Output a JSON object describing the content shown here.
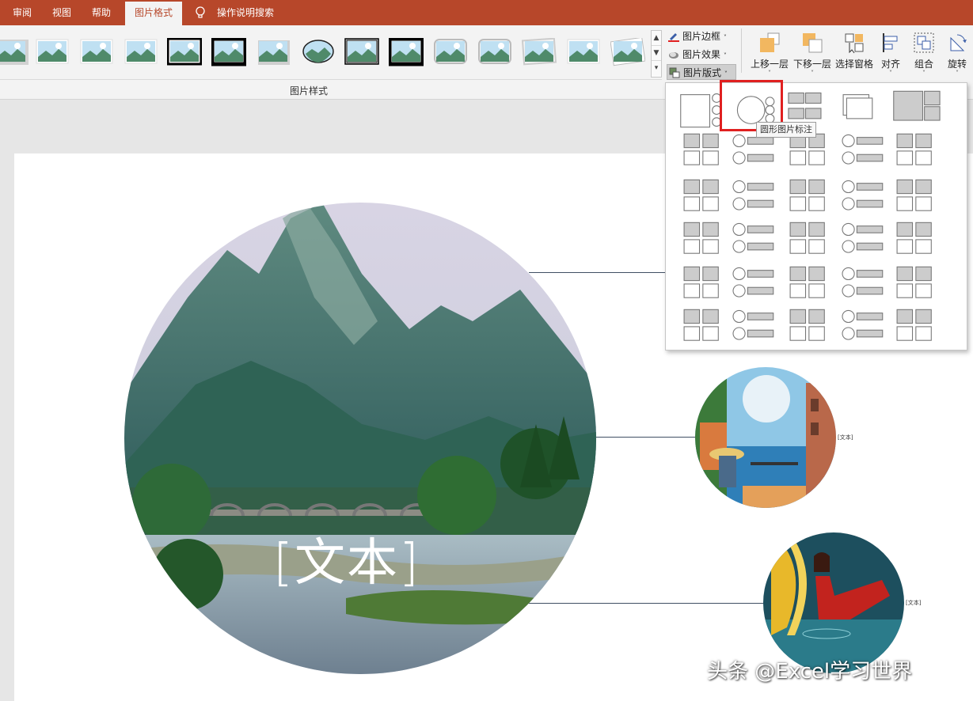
{
  "tabs": [
    {
      "label": "审阅"
    },
    {
      "label": "视图"
    },
    {
      "label": "帮助"
    },
    {
      "label": "图片格式",
      "active": true
    },
    {
      "label": "操作说明搜索"
    }
  ],
  "ribbon": {
    "picture_styles_group_label": "图片样式",
    "commands": {
      "border": "图片边框",
      "effects": "图片效果",
      "layout": "图片版式"
    },
    "arrange": {
      "bring_forward": "上移一层",
      "send_backward": "下移一层",
      "selection_pane": "选择窗格",
      "align": "对齐",
      "group": "组合",
      "rotate": "旋转"
    }
  },
  "layout_gallery": {
    "tooltip": "圆形图片标注",
    "highlighted_index": 1
  },
  "slide": {
    "main_text": "[文本]",
    "small_text_1": "[文本]",
    "small_text_2": "[文本]"
  },
  "watermark": "头条 @Excel学习世界",
  "colors": {
    "accent": "#b7472a",
    "highlight": "#e02020"
  }
}
